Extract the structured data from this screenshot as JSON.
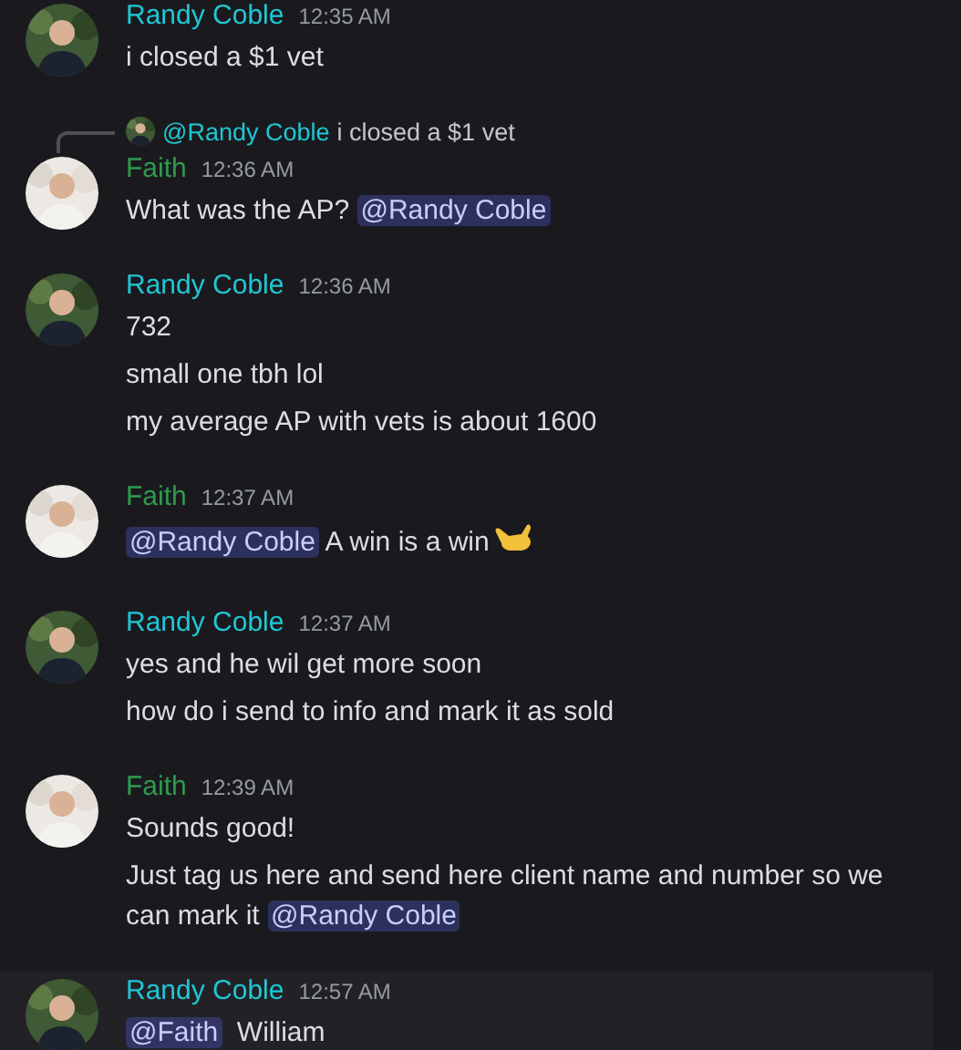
{
  "messages": [
    {
      "author": "Randy Coble",
      "color": "#1fc7d4",
      "time": "12:35 AM",
      "lines": [
        [
          {
            "kind": "text",
            "text": "i closed a $1 vet"
          }
        ]
      ]
    },
    {
      "author": "Faith",
      "color": "#2e9b4e",
      "time": "12:36 AM",
      "reply": {
        "author": "@Randy Coble",
        "text": "i closed a $1 vet"
      },
      "lines": [
        [
          {
            "kind": "text",
            "text": "What was the AP? "
          },
          {
            "kind": "mention",
            "text": "@Randy Coble"
          }
        ]
      ]
    },
    {
      "author": "Randy Coble",
      "color": "#1fc7d4",
      "time": "12:36 AM",
      "lines": [
        [
          {
            "kind": "text",
            "text": "732"
          }
        ],
        [
          {
            "kind": "text",
            "text": "small one tbh lol"
          }
        ],
        [
          {
            "kind": "text",
            "text": "my average AP with vets is about 1600"
          }
        ]
      ]
    },
    {
      "author": "Faith",
      "color": "#2e9b4e",
      "time": "12:37 AM",
      "lines": [
        [
          {
            "kind": "mention",
            "text": "@Randy Coble"
          },
          {
            "kind": "text",
            "text": " A win is a win"
          },
          {
            "kind": "emoji"
          }
        ]
      ]
    },
    {
      "author": "Randy Coble",
      "color": "#1fc7d4",
      "time": "12:37 AM",
      "lines": [
        [
          {
            "kind": "text",
            "text": "yes and he wil get more soon"
          }
        ],
        [
          {
            "kind": "text",
            "text": "how do i send to info and mark it as sold"
          }
        ]
      ]
    },
    {
      "author": "Faith",
      "color": "#2e9b4e",
      "time": "12:39 AM",
      "lines": [
        [
          {
            "kind": "text",
            "text": "Sounds good!"
          }
        ],
        [
          {
            "kind": "text",
            "text": "Just tag us here and send here client name and number so we can mark it "
          },
          {
            "kind": "mention",
            "text": "@Randy Coble"
          }
        ]
      ]
    },
    {
      "author": "Randy Coble",
      "color": "#1fc7d4",
      "time": "12:57 AM",
      "hovered": true,
      "lines": [
        [
          {
            "kind": "mention",
            "text": "@Faith"
          },
          {
            "kind": "text",
            "text": "  William"
          }
        ]
      ]
    }
  ]
}
